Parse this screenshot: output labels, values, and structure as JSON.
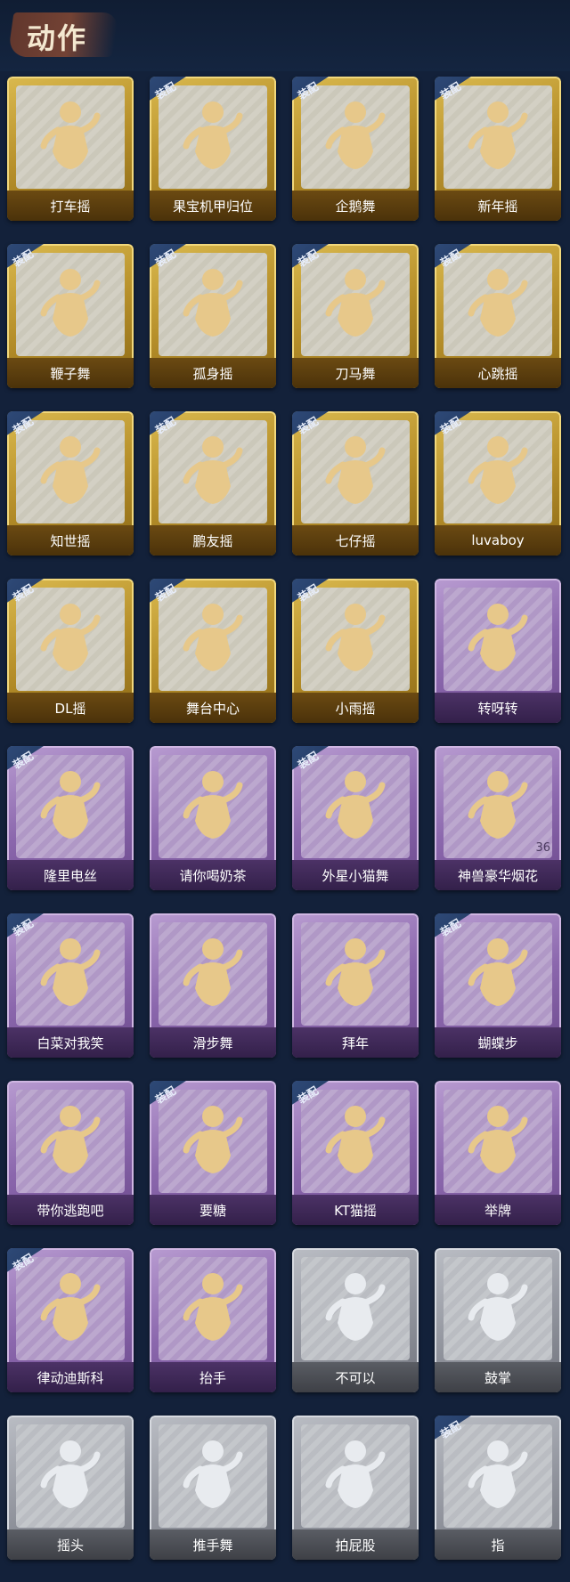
{
  "header": {
    "title": "动作"
  },
  "equip_label": "装配",
  "colors": {
    "gold": "#c99e35",
    "purple": "#8b67ad",
    "grey": "#9497a0",
    "figure_gold": "#e7c88a",
    "figure_grey": "#e8ebef"
  },
  "items": [
    {
      "label": "打车摇",
      "tier": "gold",
      "equipped": false
    },
    {
      "label": "果宝机甲归位",
      "tier": "gold",
      "equipped": true
    },
    {
      "label": "企鹅舞",
      "tier": "gold",
      "equipped": true
    },
    {
      "label": "新年摇",
      "tier": "gold",
      "equipped": true
    },
    {
      "label": "鞭子舞",
      "tier": "gold",
      "equipped": true
    },
    {
      "label": "孤身摇",
      "tier": "gold",
      "equipped": true
    },
    {
      "label": "刀马舞",
      "tier": "gold",
      "equipped": true
    },
    {
      "label": "心跳摇",
      "tier": "gold",
      "equipped": true
    },
    {
      "label": "知世摇",
      "tier": "gold",
      "equipped": true
    },
    {
      "label": "鹏友摇",
      "tier": "gold",
      "equipped": true
    },
    {
      "label": "七仔摇",
      "tier": "gold",
      "equipped": true
    },
    {
      "label": "luvaboy",
      "tier": "gold",
      "equipped": true
    },
    {
      "label": "DL摇",
      "tier": "gold",
      "equipped": true
    },
    {
      "label": "舞台中心",
      "tier": "gold",
      "equipped": true
    },
    {
      "label": "小雨摇",
      "tier": "gold",
      "equipped": true
    },
    {
      "label": "转呀转",
      "tier": "purple",
      "equipped": false
    },
    {
      "label": "隆里电丝",
      "tier": "purple",
      "equipped": true
    },
    {
      "label": "请你喝奶茶",
      "tier": "purple",
      "equipped": false
    },
    {
      "label": "外星小猫舞",
      "tier": "purple",
      "equipped": true
    },
    {
      "label": "神兽豪华烟花",
      "tier": "purple",
      "equipped": false,
      "count": "36"
    },
    {
      "label": "白菜对我笑",
      "tier": "purple",
      "equipped": true
    },
    {
      "label": "滑步舞",
      "tier": "purple",
      "equipped": false
    },
    {
      "label": "拜年",
      "tier": "purple",
      "equipped": false
    },
    {
      "label": "蝴蝶步",
      "tier": "purple",
      "equipped": true
    },
    {
      "label": "带你逃跑吧",
      "tier": "purple",
      "equipped": false
    },
    {
      "label": "要糖",
      "tier": "purple",
      "equipped": true
    },
    {
      "label": "KT猫摇",
      "tier": "purple",
      "equipped": true
    },
    {
      "label": "举牌",
      "tier": "purple",
      "equipped": false
    },
    {
      "label": "律动迪斯科",
      "tier": "purple",
      "equipped": true
    },
    {
      "label": "抬手",
      "tier": "purple",
      "equipped": false
    },
    {
      "label": "不可以",
      "tier": "grey",
      "equipped": false
    },
    {
      "label": "鼓掌",
      "tier": "grey",
      "equipped": false
    },
    {
      "label": "摇头",
      "tier": "grey",
      "equipped": false
    },
    {
      "label": "推手舞",
      "tier": "grey",
      "equipped": false
    },
    {
      "label": "拍屁股",
      "tier": "grey",
      "equipped": false
    },
    {
      "label": "指",
      "tier": "grey",
      "equipped": true
    }
  ]
}
